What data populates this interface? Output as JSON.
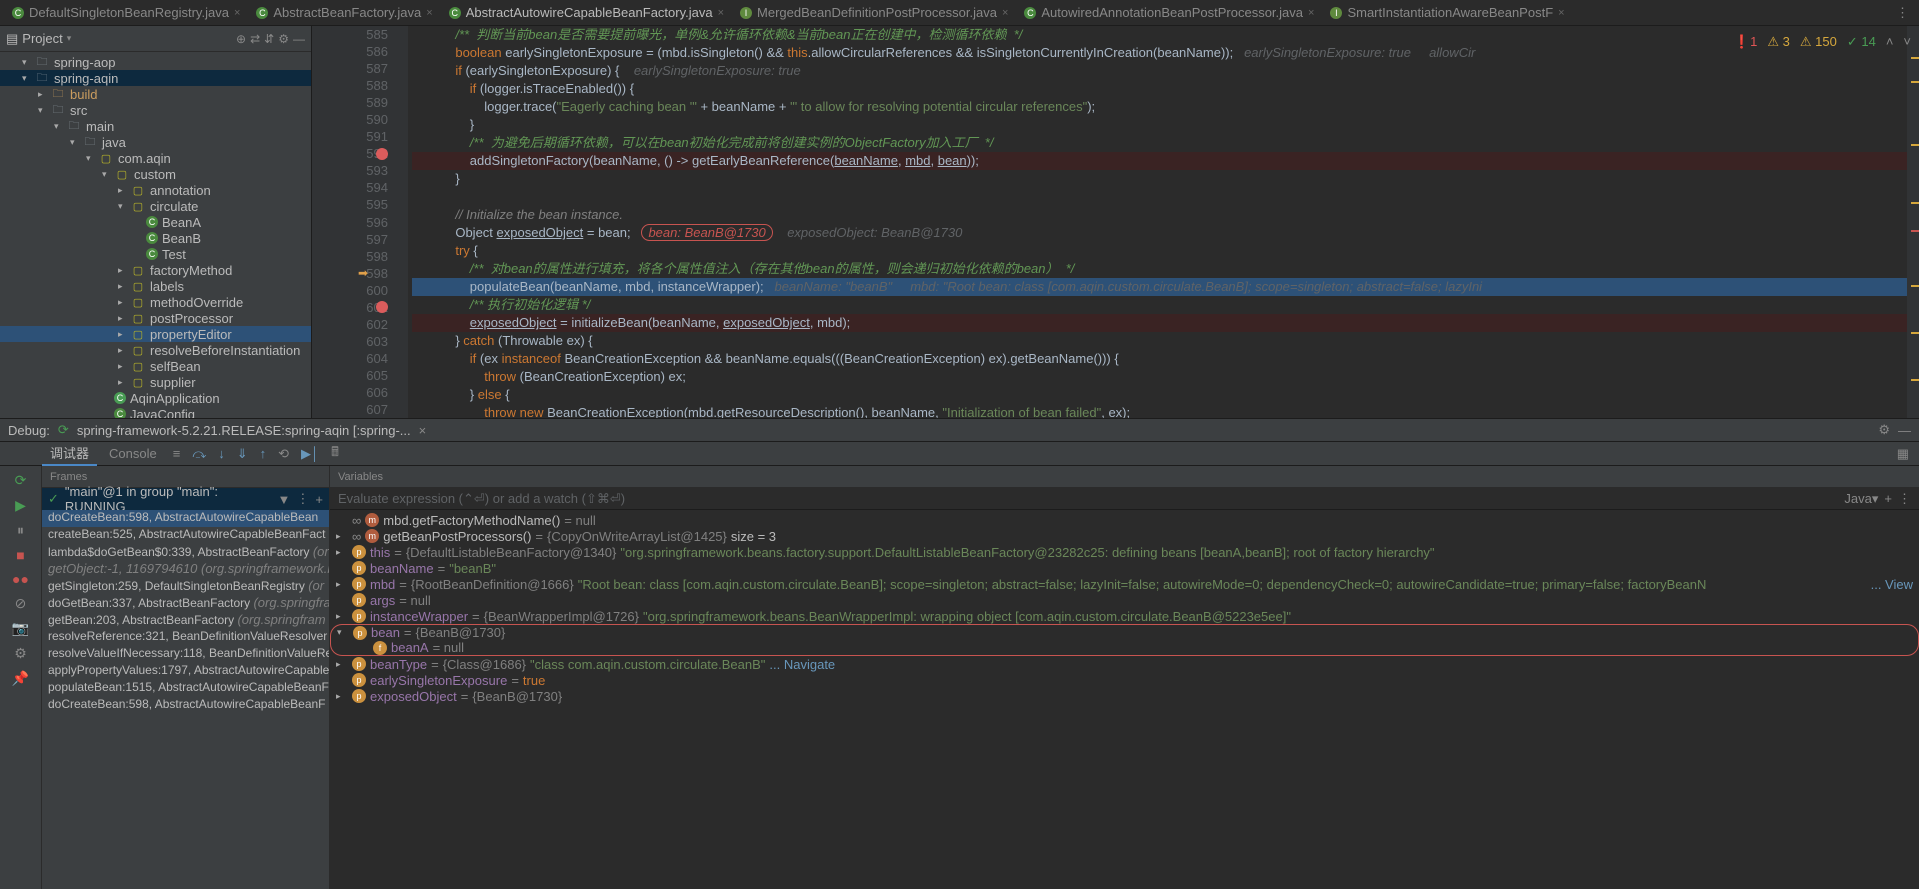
{
  "tabs": [
    {
      "label": "DefaultSingletonBeanRegistry.java",
      "icon": "C"
    },
    {
      "label": "AbstractBeanFactory.java",
      "icon": "C"
    },
    {
      "label": "AbstractAutowireCapableBeanFactory.java",
      "icon": "C",
      "active": true
    },
    {
      "label": "MergedBeanDefinitionPostProcessor.java",
      "icon": "I"
    },
    {
      "label": "AutowiredAnnotationBeanPostProcessor.java",
      "icon": "C"
    },
    {
      "label": "SmartInstantiationAwareBeanPostF",
      "icon": "I"
    }
  ],
  "project": {
    "title": "Project",
    "tree": [
      {
        "indent": 1,
        "arrow": "▾",
        "icon": "📁",
        "label": "spring-aop"
      },
      {
        "indent": 1,
        "arrow": "▾",
        "icon": "📁",
        "label": "spring-aqin",
        "hl": true
      },
      {
        "indent": 2,
        "arrow": "▸",
        "icon": "📁",
        "label": "build",
        "open": true
      },
      {
        "indent": 2,
        "arrow": "▾",
        "icon": "📁",
        "label": "src"
      },
      {
        "indent": 3,
        "arrow": "▾",
        "icon": "📁",
        "label": "main"
      },
      {
        "indent": 4,
        "arrow": "▾",
        "icon": "📁",
        "label": "java"
      },
      {
        "indent": 5,
        "arrow": "▾",
        "icon": "📦",
        "label": "com.aqin"
      },
      {
        "indent": 6,
        "arrow": "▾",
        "icon": "📦",
        "label": "custom"
      },
      {
        "indent": 7,
        "arrow": "▸",
        "icon": "📦",
        "label": "annotation"
      },
      {
        "indent": 7,
        "arrow": "▾",
        "icon": "📦",
        "label": "circulate"
      },
      {
        "indent": 8,
        "arrow": "",
        "icon": "C",
        "label": "BeanA",
        "class": true
      },
      {
        "indent": 8,
        "arrow": "",
        "icon": "C",
        "label": "BeanB",
        "class": true
      },
      {
        "indent": 8,
        "arrow": "",
        "icon": "C",
        "label": "Test",
        "class": true
      },
      {
        "indent": 7,
        "arrow": "▸",
        "icon": "📦",
        "label": "factoryMethod"
      },
      {
        "indent": 7,
        "arrow": "▸",
        "icon": "📦",
        "label": "labels"
      },
      {
        "indent": 7,
        "arrow": "▸",
        "icon": "📦",
        "label": "methodOverride"
      },
      {
        "indent": 7,
        "arrow": "▸",
        "icon": "📦",
        "label": "postProcessor"
      },
      {
        "indent": 7,
        "arrow": "▸",
        "icon": "📦",
        "label": "propertyEditor",
        "sel": true
      },
      {
        "indent": 7,
        "arrow": "▸",
        "icon": "📦",
        "label": "resolveBeforeInstantiation"
      },
      {
        "indent": 7,
        "arrow": "▸",
        "icon": "📦",
        "label": "selfBean"
      },
      {
        "indent": 7,
        "arrow": "▸",
        "icon": "📦",
        "label": "supplier"
      },
      {
        "indent": 6,
        "arrow": "",
        "icon": "C",
        "label": "AqinApplication",
        "class": true,
        "green": true
      },
      {
        "indent": 6,
        "arrow": "",
        "icon": "C",
        "label": "JavaConfig",
        "class": true
      }
    ]
  },
  "editor": {
    "status": {
      "errors": "1",
      "warnings": "3",
      "weak": "150",
      "ok": "14"
    },
    "lines": [
      {
        "n": 585,
        "seg": [
          {
            "c": "cmj",
            "t": "            /**  判断当前bean是否需要提前曝光，单例&允许循环依赖&当前bean正在创建中，检测循环依赖  */"
          }
        ]
      },
      {
        "n": 586,
        "seg": [
          {
            "c": "",
            "t": "            "
          },
          {
            "c": "kw",
            "t": "boolean"
          },
          {
            "c": "",
            "t": " earlySingletonExposure = (mbd.isSingleton() && "
          },
          {
            "c": "kw",
            "t": "this"
          },
          {
            "c": "",
            "t": ".allowCircularReferences && isSingletonCurrentlyInCreation(beanName));   "
          },
          {
            "c": "inline-hint",
            "t": "earlySingletonExposure: true     allowCir"
          }
        ]
      },
      {
        "n": 587,
        "seg": [
          {
            "c": "",
            "t": "            "
          },
          {
            "c": "kw",
            "t": "if"
          },
          {
            "c": "",
            "t": " (earlySingletonExposure) {    "
          },
          {
            "c": "inline-hint",
            "t": "earlySingletonExposure: true"
          }
        ]
      },
      {
        "n": 588,
        "seg": [
          {
            "c": "",
            "t": "                "
          },
          {
            "c": "kw",
            "t": "if"
          },
          {
            "c": "",
            "t": " (logger.isTraceEnabled()) {"
          }
        ]
      },
      {
        "n": 589,
        "seg": [
          {
            "c": "",
            "t": "                    logger.trace("
          },
          {
            "c": "str",
            "t": "\"Eagerly caching bean '\""
          },
          {
            "c": "",
            "t": " + beanName + "
          },
          {
            "c": "str",
            "t": "\"' to allow for resolving potential circular references\""
          },
          {
            "c": "",
            "t": ");"
          }
        ]
      },
      {
        "n": 590,
        "seg": [
          {
            "c": "",
            "t": "                }"
          }
        ]
      },
      {
        "n": 591,
        "seg": [
          {
            "c": "cmj",
            "t": "                /**  为避免后期循环依赖，可以在bean初始化完成前将创建实例的ObjectFactory加入工厂  */"
          }
        ]
      },
      {
        "n": 592,
        "bp": true,
        "seg": [
          {
            "c": "",
            "t": "                addSingletonFactory(beanName, () -> getEarlyBeanReference("
          },
          {
            "c": "underlined",
            "t": "beanName"
          },
          {
            "c": "",
            "t": ", "
          },
          {
            "c": "underlined",
            "t": "mbd"
          },
          {
            "c": "",
            "t": ", "
          },
          {
            "c": "underlined",
            "t": "bean"
          },
          {
            "c": "",
            "t": "));"
          }
        ]
      },
      {
        "n": 593,
        "seg": [
          {
            "c": "",
            "t": "            }"
          }
        ]
      },
      {
        "n": 594,
        "seg": [
          {
            "c": "",
            "t": ""
          }
        ]
      },
      {
        "n": 595,
        "seg": [
          {
            "c": "",
            "t": "            "
          },
          {
            "c": "cm",
            "t": "// Initialize the bean instance."
          }
        ]
      },
      {
        "n": 596,
        "seg": [
          {
            "c": "",
            "t": "            Object "
          },
          {
            "c": "underlined",
            "t": "exposedObject"
          },
          {
            "c": "",
            "t": " = bean;   "
          },
          {
            "c": "hl-red",
            "t": "bean: BeanB@1730"
          },
          {
            "c": "",
            "t": "    "
          },
          {
            "c": "inline-hint",
            "t": "exposedObject: BeanB@1730"
          }
        ]
      },
      {
        "n": 597,
        "seg": [
          {
            "c": "",
            "t": "            "
          },
          {
            "c": "kw",
            "t": "try"
          },
          {
            "c": "",
            "t": " {"
          }
        ]
      },
      {
        "n": 598,
        "seg": [
          {
            "c": "cmj",
            "t": "                /**  对bean的属性进行填充，将各个属性值注入（存在其他bean的属性，则会递归初始化依赖的bean）  */"
          }
        ]
      },
      {
        "n": 599,
        "exec": true,
        "arrow": true,
        "seg": [
          {
            "c": "",
            "t": "                populateBean(beanName, mbd, instanceWrapper);   "
          },
          {
            "c": "inline-hint",
            "t": "beanName: \"beanB\"     mbd: \"Root bean: class [com.aqin.custom.circulate.BeanB]; scope=singleton; abstract=false; lazyIni"
          }
        ]
      },
      {
        "n": 600,
        "seg": [
          {
            "c": "cmj",
            "t": "                /** 执行初始化逻辑 */"
          }
        ]
      },
      {
        "n": 601,
        "bp": true,
        "seg": [
          {
            "c": "",
            "t": "                "
          },
          {
            "c": "underlined",
            "t": "exposedObject"
          },
          {
            "c": "",
            "t": " = initializeBean(beanName, "
          },
          {
            "c": "underlined",
            "t": "exposedObject"
          },
          {
            "c": "",
            "t": ", mbd);"
          }
        ]
      },
      {
        "n": 602,
        "seg": [
          {
            "c": "",
            "t": "            } "
          },
          {
            "c": "kw",
            "t": "catch"
          },
          {
            "c": "",
            "t": " (Throwable ex) {"
          }
        ]
      },
      {
        "n": 603,
        "seg": [
          {
            "c": "",
            "t": "                "
          },
          {
            "c": "kw",
            "t": "if"
          },
          {
            "c": "",
            "t": " (ex "
          },
          {
            "c": "kw",
            "t": "instanceof"
          },
          {
            "c": "",
            "t": " BeanCreationException && beanName.equals(((BeanCreationException) ex).getBeanName())) {"
          }
        ]
      },
      {
        "n": 604,
        "seg": [
          {
            "c": "",
            "t": "                    "
          },
          {
            "c": "kw",
            "t": "throw"
          },
          {
            "c": "",
            "t": " (BeanCreationException) ex;"
          }
        ]
      },
      {
        "n": 605,
        "seg": [
          {
            "c": "",
            "t": "                } "
          },
          {
            "c": "kw",
            "t": "else"
          },
          {
            "c": "",
            "t": " {"
          }
        ]
      },
      {
        "n": 606,
        "seg": [
          {
            "c": "",
            "t": "                    "
          },
          {
            "c": "kw",
            "t": "throw new"
          },
          {
            "c": "",
            "t": " BeanCreationException(mbd.getResourceDescription(), beanName, "
          },
          {
            "c": "str",
            "t": "\"Initialization of bean failed\""
          },
          {
            "c": "",
            "t": ", ex);"
          }
        ]
      },
      {
        "n": 607,
        "seg": [
          {
            "c": "",
            "t": "                }"
          }
        ]
      }
    ]
  },
  "debug": {
    "label": "Debug:",
    "config": "spring-framework-5.2.21.RELEASE:spring-aqin [:spring-...",
    "tabs": {
      "debugger": "调试器",
      "console": "Console"
    },
    "frames": {
      "title": "Frames",
      "thread": "\"main\"@1 in group \"main\": RUNNING",
      "list": [
        {
          "t": "doCreateBean:598, AbstractAutowireCapableBean",
          "sel": true
        },
        {
          "t": "createBean:525, AbstractAutowireCapableBeanFact"
        },
        {
          "t": "lambda$doGetBean$0:339, AbstractBeanFactory ",
          "dim": "(or"
        },
        {
          "t": "getObject:-1, 1169794610 ",
          "dim": "(org.springframework.bea",
          "alldim": true
        },
        {
          "t": "getSingleton:259, DefaultSingletonBeanRegistry ",
          "dim": "(or"
        },
        {
          "t": "doGetBean:337, AbstractBeanFactory ",
          "dim": "(org.springfra"
        },
        {
          "t": "getBean:203, AbstractBeanFactory ",
          "dim": "(org.springfram"
        },
        {
          "t": "resolveReference:321, BeanDefinitionValueResolver"
        },
        {
          "t": "resolveValueIfNecessary:118, BeanDefinitionValueRe"
        },
        {
          "t": "applyPropertyValues:1797, AbstractAutowireCapableB"
        },
        {
          "t": "populateBean:1515, AbstractAutowireCapableBeanF"
        },
        {
          "t": "doCreateBean:598, AbstractAutowireCapableBeanF"
        }
      ]
    },
    "vars": {
      "title": "Variables",
      "eval": "Evaluate expression (⌃⏎) or add a watch (⇧⌘⏎)",
      "lang": "Java",
      "list": [
        {
          "indent": 0,
          "arrow": "",
          "icon": "m",
          "name": "mbd.getFactoryMethodName()",
          "inf": true,
          "val": " = null"
        },
        {
          "indent": 0,
          "arrow": "▸",
          "icon": "m",
          "name": "getBeanPostProcessors()",
          "inf": true,
          "val": " = ",
          "gval": "{CopyOnWriteArrayList@1425}",
          "tail": "  size = 3"
        },
        {
          "indent": 0,
          "arrow": "▸",
          "icon": "p",
          "name": "this",
          "val": " = ",
          "gval": "{DefaultListableBeanFactory@1340}",
          "str": " \"org.springframework.beans.factory.support.DefaultListableBeanFactory@23282c25: defining beans [beanA,beanB]; root of factory hierarchy\""
        },
        {
          "indent": 0,
          "arrow": "",
          "icon": "p",
          "name": "beanName",
          "val": " = ",
          "str": "\"beanB\""
        },
        {
          "indent": 0,
          "arrow": "▸",
          "icon": "p",
          "name": "mbd",
          "val": " = ",
          "gval": "{RootBeanDefinition@1666}",
          "str": " \"Root bean: class [com.aqin.custom.circulate.BeanB]; scope=singleton; abstract=false; lazyInit=false; autowireMode=0; dependencyCheck=0; autowireCandidate=true; primary=false; factoryBeanN",
          "view": "... View"
        },
        {
          "indent": 0,
          "arrow": "",
          "icon": "p",
          "name": "args",
          "val": " = null"
        },
        {
          "indent": 0,
          "arrow": "▸",
          "icon": "p",
          "name": "instanceWrapper",
          "val": " = ",
          "gval": "{BeanWrapperImpl@1726}",
          "str": " \"org.springframework.beans.BeanWrapperImpl: wrapping object [com.aqin.custom.circulate.BeanB@5223e5ee]\""
        },
        {
          "indent": 0,
          "arrow": "▾",
          "icon": "p",
          "name": "bean",
          "val": " = ",
          "gval": "{BeanB@1730}",
          "red": true
        },
        {
          "indent": 1,
          "arrow": "",
          "icon": "f",
          "name": "beanA",
          "val": " = null",
          "red": true
        },
        {
          "indent": 0,
          "arrow": "▸",
          "icon": "p",
          "name": "beanType",
          "val": " = ",
          "gval": "{Class@1686}",
          "str": " \"class com.aqin.custom.circulate.BeanB\"",
          "link": "... Navigate"
        },
        {
          "indent": 0,
          "arrow": "",
          "icon": "p",
          "name": "earlySingletonExposure",
          "val": " = ",
          "bool": "true"
        },
        {
          "indent": 0,
          "arrow": "▸",
          "icon": "p",
          "name": "exposedObject",
          "val": " = ",
          "gval": "{BeanB@1730}"
        }
      ]
    }
  }
}
